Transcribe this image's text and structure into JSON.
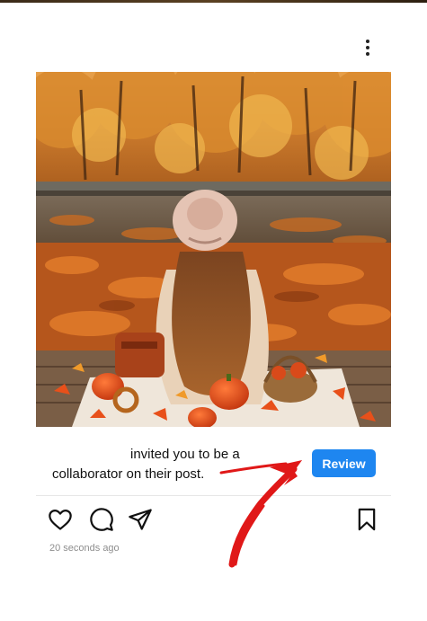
{
  "post": {
    "image_alt": "Woman in a pink hat sitting on a wooden dock among autumn leaves, pumpkins and a basket by a pond in an orange forest",
    "invite_line1": "invited you to be a",
    "invite_line2": "collaborator on their post.",
    "review_label": "Review",
    "timestamp": "20 seconds ago"
  },
  "icons": {
    "more": "more-vertical-icon",
    "like": "heart-icon",
    "comment": "comment-bubble-icon",
    "share": "send-icon",
    "save": "bookmark-icon",
    "overlay": "red-hand-drawn-arrow"
  },
  "colors": {
    "review_button": "#1e86f0",
    "arrow": "#e01818",
    "timestamp": "#8e8e8e"
  }
}
